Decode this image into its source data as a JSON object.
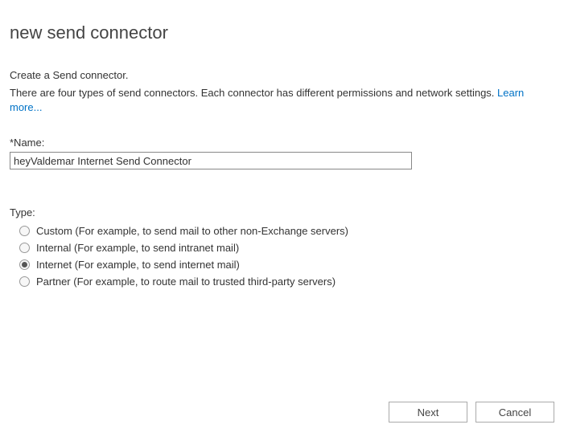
{
  "title": "new send connector",
  "intro1": "Create a Send connector.",
  "intro2_prefix": "There are four types of send connectors. Each connector has different permissions and network settings. ",
  "learn_more_label": "Learn more...",
  "name_label": "*Name:",
  "name_value": "heyValdemar Internet Send Connector",
  "type_label": "Type:",
  "type_options": [
    {
      "label": "Custom (For example, to send mail to other non-Exchange servers)",
      "selected": false
    },
    {
      "label": "Internal (For example, to send intranet mail)",
      "selected": false
    },
    {
      "label": "Internet (For example, to send internet mail)",
      "selected": true
    },
    {
      "label": "Partner (For example, to route mail to trusted third-party servers)",
      "selected": false
    }
  ],
  "buttons": {
    "next": "Next",
    "cancel": "Cancel"
  }
}
